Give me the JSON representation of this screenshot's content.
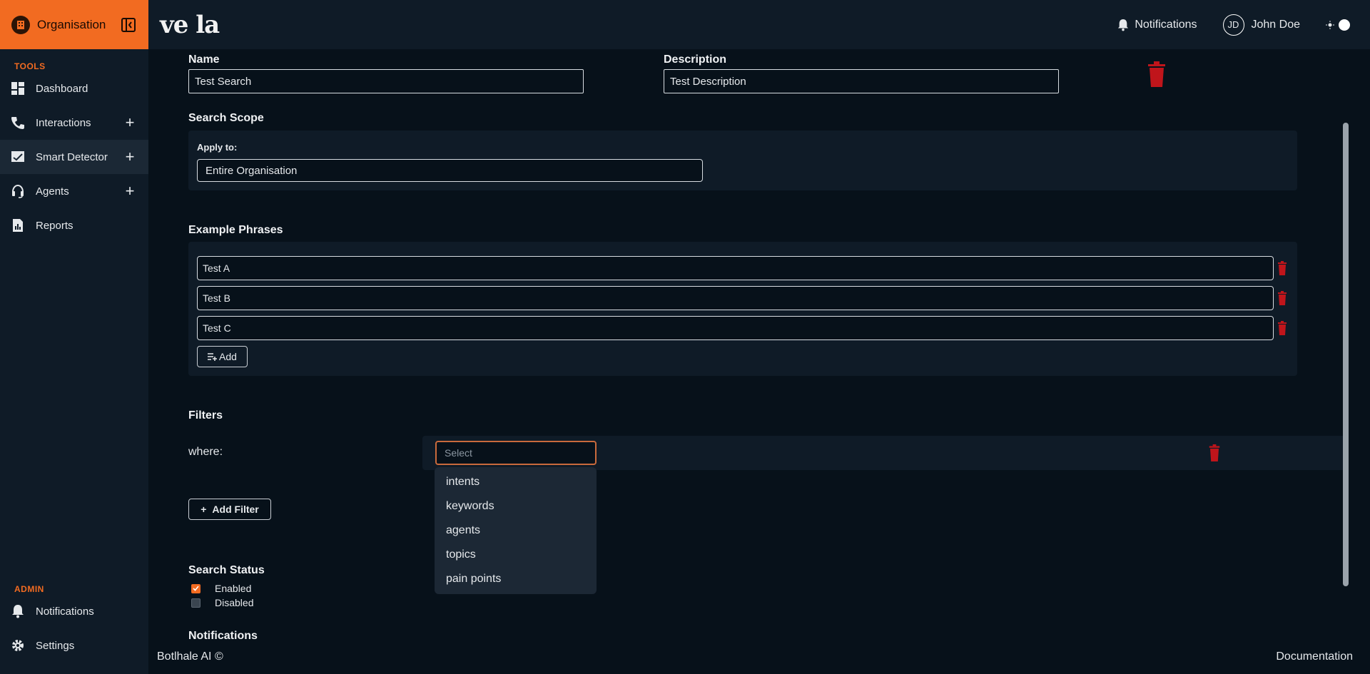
{
  "sidebar": {
    "org_name": "Organisation",
    "tools_label": "TOOLS",
    "admin_label": "ADMIN",
    "tools": [
      {
        "label": "Dashboard",
        "icon": "dashboard-icon",
        "expandable": false
      },
      {
        "label": "Interactions",
        "icon": "phone-icon",
        "expandable": true
      },
      {
        "label": "Smart Detector",
        "icon": "chart-check-icon",
        "expandable": true,
        "active": true
      },
      {
        "label": "Agents",
        "icon": "headset-icon",
        "expandable": true
      },
      {
        "label": "Reports",
        "icon": "report-icon",
        "expandable": false
      }
    ],
    "admin": [
      {
        "label": "Notifications",
        "icon": "bell-icon"
      },
      {
        "label": "Settings",
        "icon": "gear-icon"
      }
    ]
  },
  "topbar": {
    "logo_text": "ve la",
    "notifications_label": "Notifications",
    "user_initials": "JD",
    "user_name": "John Doe"
  },
  "form": {
    "name_label": "Name",
    "name_value": "Test Search",
    "description_label": "Description",
    "description_value": "Test Description",
    "scope_title": "Search Scope",
    "apply_to_label": "Apply to:",
    "apply_to_value": "Entire Organisation",
    "phrases_title": "Example Phrases",
    "phrases": [
      "Test A",
      "Test B",
      "Test C"
    ],
    "add_label": "Add",
    "filters_title": "Filters",
    "where_label": "where:",
    "select_placeholder": "Select",
    "filter_options": [
      "intents",
      "keywords",
      "agents",
      "topics",
      "pain points"
    ],
    "add_filter_label": "Add Filter",
    "status_title": "Search Status",
    "status_enabled": "Enabled",
    "status_disabled": "Disabled",
    "enabled_checked": true,
    "disabled_checked": false,
    "notifications_title": "Notifications"
  },
  "footer": {
    "left": "Botlhale AI ©",
    "right": "Documentation"
  },
  "colors": {
    "accent": "#f26b21",
    "danger": "#c0151b",
    "background": "#07111a",
    "panel": "#0f1b27"
  }
}
